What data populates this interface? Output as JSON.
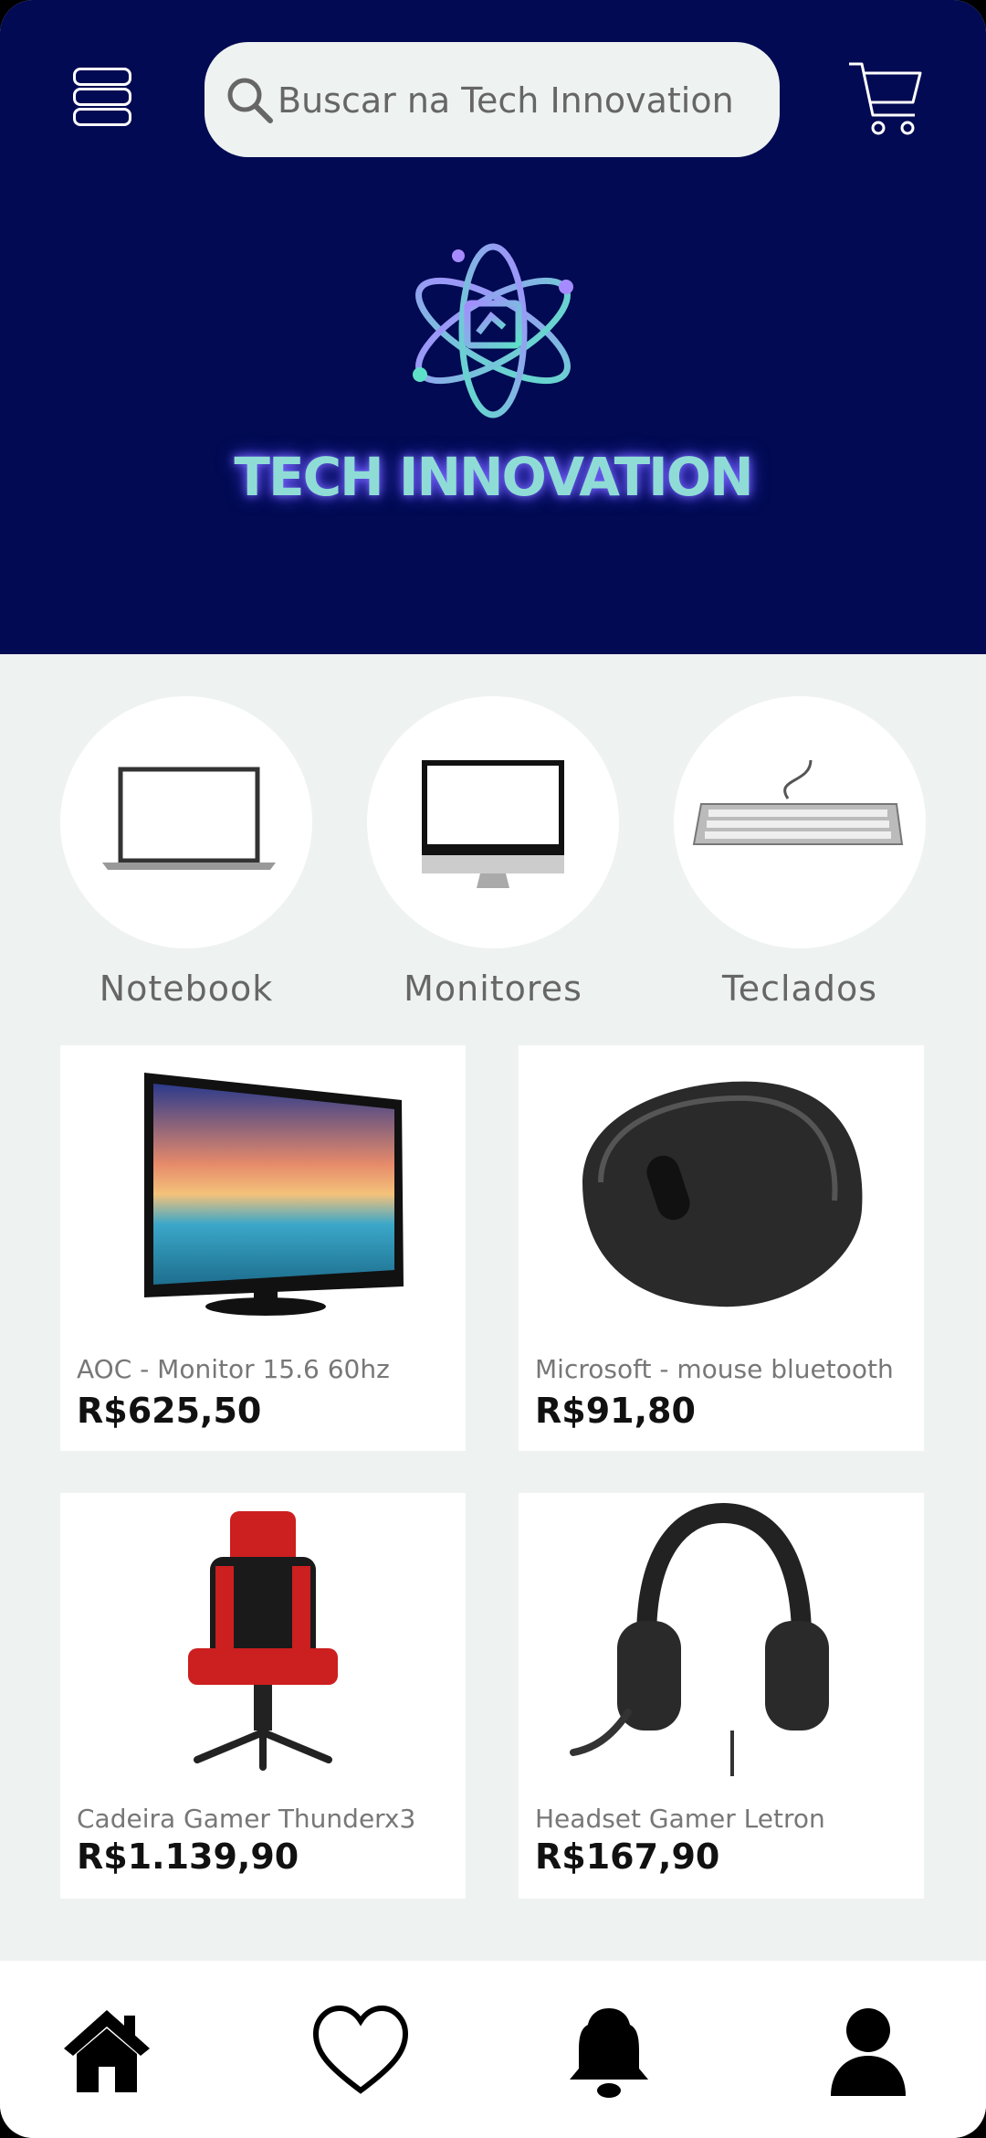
{
  "search": {
    "placeholder": "Buscar na Tech Innovation"
  },
  "header": {
    "brand": "TECH INNOVATION"
  },
  "categories": [
    {
      "label": "Notebook",
      "icon": "laptop-icon"
    },
    {
      "label": "Monitores",
      "icon": "monitor-icon"
    },
    {
      "label": "Teclados",
      "icon": "keyboard-icon"
    }
  ],
  "products": [
    {
      "name": "AOC - Monitor 15.6 60hz",
      "price": "R$625,50"
    },
    {
      "name": "Microsoft - mouse bluetooth",
      "price": "R$91,80"
    },
    {
      "name": "Cadeira Gamer Thunderx3",
      "price": "R$1.139,90"
    },
    {
      "name": "Headset Gamer Letron",
      "price": "R$167,90"
    }
  ],
  "nav": [
    "home-icon",
    "heart-icon",
    "bell-icon",
    "user-icon"
  ],
  "colors": {
    "header": "#010a52",
    "background": "#eef2f1",
    "brand_glow": "#7d6cff"
  }
}
